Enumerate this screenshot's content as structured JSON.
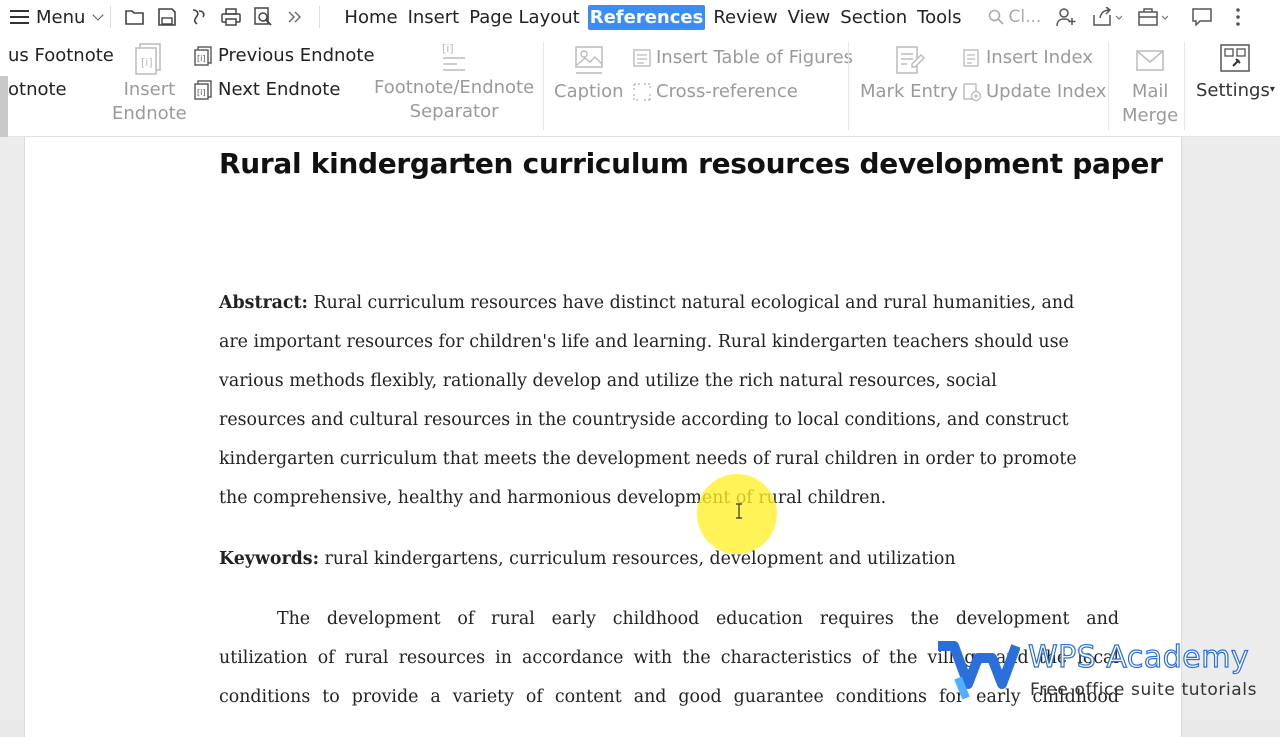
{
  "menubar": {
    "menu_label": "Menu",
    "tabs": [
      "Home",
      "Insert",
      "Page Layout",
      "References",
      "Review",
      "View",
      "Section",
      "Tools"
    ],
    "active_tab": "References",
    "search_text": "Cl..."
  },
  "ribbon": {
    "footnote_prev": "us Footnote",
    "footnote_next": "otnote",
    "insert_endnote": [
      "Insert",
      "Endnote"
    ],
    "previous_endnote": "Previous Endnote",
    "next_endnote": "Next Endnote",
    "separator": [
      "Footnote/Endnote",
      "Separator"
    ],
    "caption": "Caption",
    "insert_table_of_figures": "Insert Table of Figures",
    "cross_reference": "Cross-reference",
    "mark_entry": "Mark Entry",
    "insert_index": "Insert Index",
    "update_index": "Update Index",
    "mail_merge": [
      "Mail",
      "Merge"
    ],
    "settings": "Settings"
  },
  "document": {
    "title": "Rural kindergarten curriculum resources development paper",
    "abstract_label": "Abstract:",
    "abstract_lines": [
      " Rural curriculum resources have distinct natural ecological and rural humanities, and",
      "are important resources for children's life and learning. Rural kindergarten teachers should use",
      "various methods flexibly, rationally develop and utilize the rich natural resources, social",
      "resources and cultural resources in the countryside according to local conditions, and construct",
      "kindergarten curriculum that meets the development needs of rural children in order to promote",
      "the comprehensive, healthy and harmonious development of rural children."
    ],
    "keywords_label": "Keywords:",
    "keywords_text": " rural kindergartens, curriculum resources, development and utilization",
    "body_lines": [
      "The development of rural early childhood education requires the development and",
      "utilization of rural resources in accordance with the characteristics of the village and the local",
      "conditions to provide a variety of content and good guarantee conditions for early childhood"
    ]
  },
  "watermark": {
    "brand": "WPS Academy",
    "tagline": "Free office suite tutorials"
  }
}
